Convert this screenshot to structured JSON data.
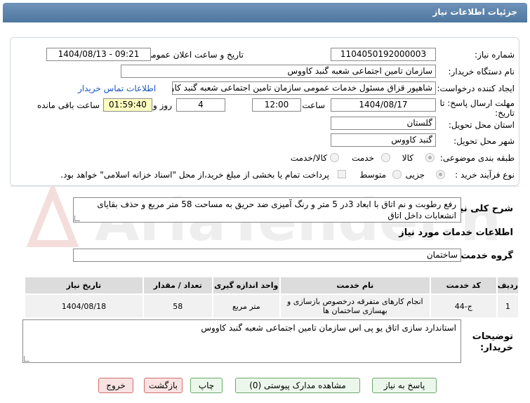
{
  "header": {
    "title": "جزئیات اطلاعات نیاز"
  },
  "fields": {
    "need_number_label": "شماره نیاز:",
    "need_number": "1104050192000003",
    "announce_label": "تاریخ و ساعت اعلان عمومی:",
    "announce_value": "1404/08/13 - 09:21",
    "buyer_org_label": "نام دستگاه خریدار:",
    "buyer_org": "سازمان تامین اجتماعی شعبه گنبد کاووس",
    "creator_label": "ایجاد کننده درخواست:",
    "creator": "شاهپور قزاق مسئول خدمات عمومی سازمان تامین اجتماعی شعبه گنبد کاووس",
    "contact_link": "اطلاعات تماس خریدار",
    "deadline_label_1": "مهلت ارسال پاسخ: تا",
    "deadline_label_2": "تاریخ:",
    "deadline_date": "1404/08/17",
    "time_label": "ساعت",
    "deadline_time": "12:00",
    "days_value": "4",
    "days_label": "روز و",
    "remaining_time": "01:59:40",
    "remaining_label": "ساعت باقی مانده",
    "province_label": "استان محل تحویل:",
    "province": "گلستان",
    "city_label": "شهر محل تحویل:",
    "city": "گنبد کاووس",
    "category_label": "طبقه بندی موضوعی:",
    "category_options": [
      "کالا",
      "خدمت",
      "کالا/خدمت"
    ],
    "category_selected": "کالا",
    "process_label": "نوع فرآیند خرید :",
    "process_options": [
      "جزیی",
      "متوسط"
    ],
    "process_selected": "جزیی",
    "payment_note": "پرداخت تمام یا بخشی از مبلغ خرید،از محل \"اسناد خزانه اسلامی\" خواهد بود."
  },
  "description": {
    "label": "شرح کلی نیاز:",
    "text": "رفع رطوبت و نم اتاق با ابعاد 3در 5 متر و رنگ آمیزی ضد حریق به مساحت 58 متر مربع و حذف بقایای انشعابات داخل اتاق"
  },
  "services": {
    "section_title": "اطلاعات خدمات مورد نیاز",
    "group_label": "گروه خدمت:",
    "group_value": "ساختمان",
    "columns": [
      "ردیف",
      "کد خدمت",
      "نام خدمت",
      "واحد اندازه گیری",
      "تعداد / مقدار",
      "تاریخ نیاز"
    ],
    "rows": [
      {
        "index": "1",
        "code": "ج-44",
        "name": "انجام کارهای متفرقه درخصوص بازسازی و بهسازی ساختمان ها",
        "unit": "متر مربع",
        "qty": "58",
        "date": "1404/08/18"
      }
    ]
  },
  "buyer_notes": {
    "label_1": "توضیحات",
    "label_2": "خریدار:",
    "text": "استاندارد سازی اتاق یو پی اس سازمان تامین اجتماعی شعبه گنبد کاووس"
  },
  "buttons": {
    "reply": "پاسخ به نیاز",
    "docs": "مشاهده مدارک پیوستی (0)",
    "print": "چاپ",
    "back": "بازگشت",
    "exit": "خروج"
  },
  "watermark": "AriaTender.net",
  "colors": {
    "header": "#5b7fa8",
    "timer_bg": "#ffffc0",
    "link": "#1a55c6"
  }
}
